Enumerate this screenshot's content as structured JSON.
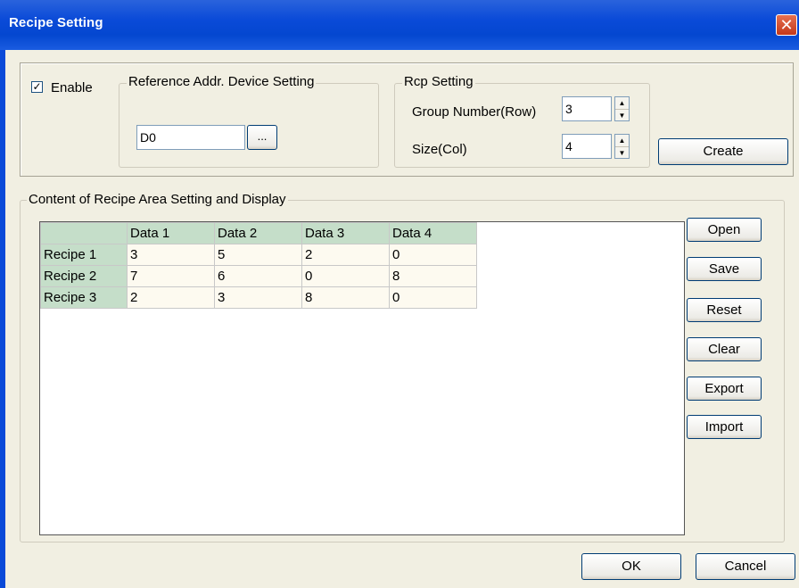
{
  "window": {
    "title": "Recipe Setting"
  },
  "enable": {
    "label": "Enable",
    "checked": true
  },
  "reference": {
    "group_label": "Reference Addr. Device Setting",
    "value": "D0",
    "browse_label": "..."
  },
  "rcp": {
    "group_label": "Rcp Setting",
    "group_number_label": "Group Number(Row)",
    "group_number_value": "3",
    "size_label": "Size(Col)",
    "size_value": "4"
  },
  "buttons": {
    "create": "Create",
    "open": "Open",
    "save": "Save",
    "reset": "Reset",
    "clear": "Clear",
    "export": "Export",
    "import": "Import",
    "ok": "OK",
    "cancel": "Cancel"
  },
  "content": {
    "group_label": "Content of Recipe Area Setting and Display",
    "columns": [
      "Data 1",
      "Data 2",
      "Data 3",
      "Data 4"
    ],
    "rows": [
      {
        "name": "Recipe 1",
        "values": [
          "3",
          "5",
          "2",
          "0"
        ]
      },
      {
        "name": "Recipe 2",
        "values": [
          "7",
          "6",
          "0",
          "8"
        ]
      },
      {
        "name": "Recipe 3",
        "values": [
          "2",
          "3",
          "8",
          "0"
        ]
      }
    ]
  }
}
